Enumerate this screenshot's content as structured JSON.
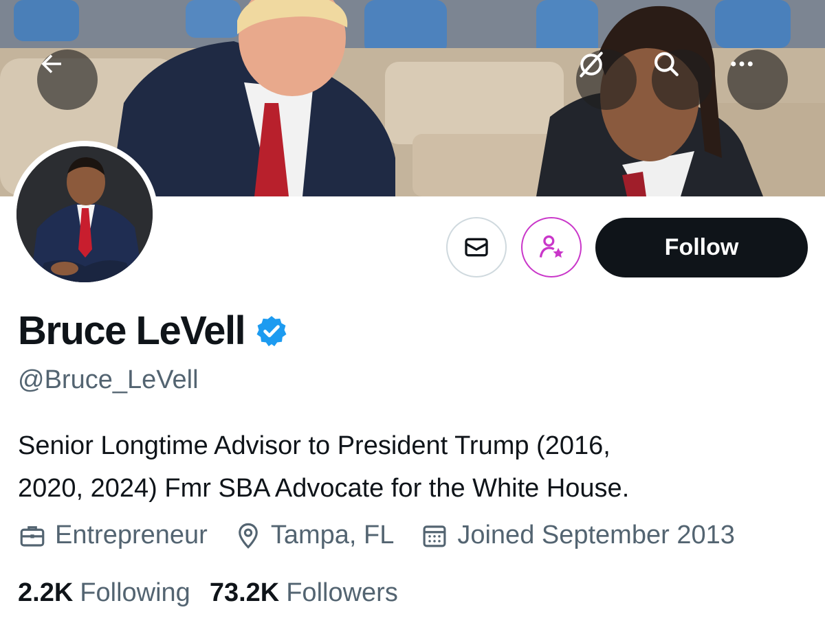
{
  "profile": {
    "name": "Bruce LeVell",
    "handle": "@Bruce_LeVell",
    "bio_line1": "Senior Longtime Advisor to President Trump (2016,",
    "bio_line2": "2020, 2024) Fmr SBA Advocate for the White House.",
    "profession": "Entrepreneur",
    "location": "Tampa, FL",
    "joined": "Joined September 2013",
    "following_count": "2.2K",
    "following_label": "Following",
    "followers_count": "73.2K",
    "followers_label": "Followers"
  },
  "actions": {
    "follow_label": "Follow"
  },
  "icons": {
    "back": "arrow-left-icon",
    "grok": "grok-icon",
    "search": "search-icon",
    "more": "more-icon",
    "message": "envelope-icon",
    "subscribe": "person-star-icon",
    "verified": "verified-badge-icon",
    "profession": "briefcase-icon",
    "location": "location-pin-icon",
    "joined": "calendar-icon"
  },
  "colors": {
    "verified": "#1d9bf0",
    "subscribe": "#c936c9",
    "follow_bg": "#0f1419",
    "secondary_text": "#536471"
  }
}
